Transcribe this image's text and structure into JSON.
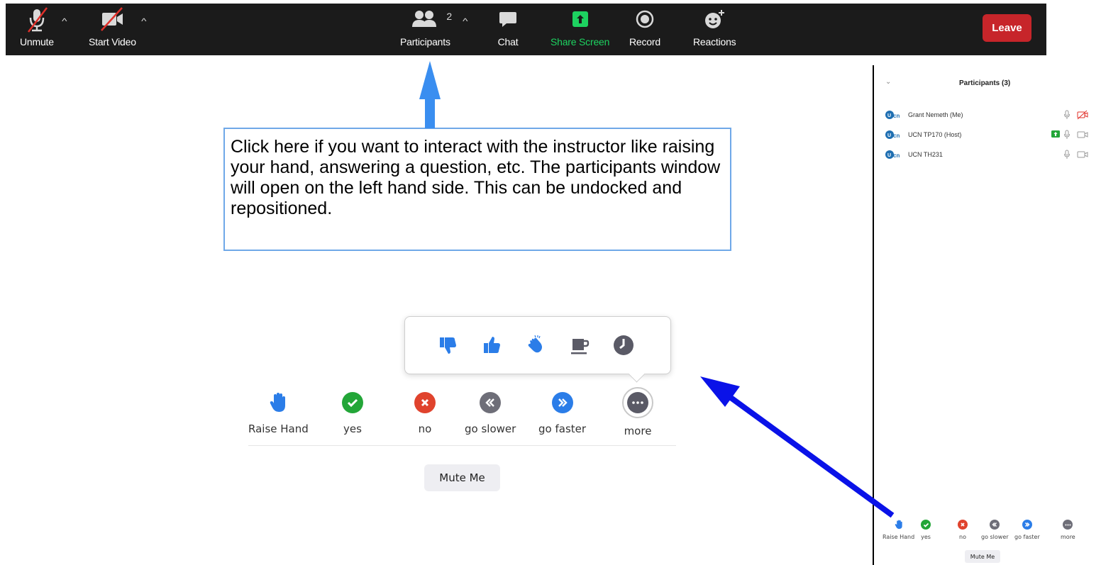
{
  "toolbar": {
    "unmute": {
      "label": "Unmute",
      "icon": "mic-muted-icon"
    },
    "start_video": {
      "label": "Start Video",
      "icon": "video-off-icon"
    },
    "participants": {
      "label": "Participants",
      "count": "2",
      "icon": "participants-icon"
    },
    "chat": {
      "label": "Chat",
      "icon": "chat-icon"
    },
    "share_screen": {
      "label": "Share Screen",
      "icon": "share-screen-icon",
      "color": "#1dd260"
    },
    "record": {
      "label": "Record",
      "icon": "record-icon"
    },
    "reactions": {
      "label": "Reactions",
      "icon": "reactions-icon"
    },
    "leave": {
      "label": "Leave",
      "color": "#c7252a"
    }
  },
  "callout": {
    "text": "Click here if you want to interact with the instructor like raising your hand, answering a question, etc.  The participants window will open on the left hand side.  This can be undocked and repositioned."
  },
  "reactions_popup": {
    "items": [
      "thumbs-down-icon",
      "thumbs-up-icon",
      "clap-icon",
      "coffee-icon",
      "clock-icon"
    ]
  },
  "feedback": {
    "raise_hand": "Raise Hand",
    "yes": "yes",
    "no": "no",
    "go_slower": "go slower",
    "go_faster": "go faster",
    "more": "more",
    "mute_me": "Mute Me",
    "colors": {
      "yes": "#23a638",
      "no": "#e0432d",
      "slower": "#6e6e78",
      "faster": "#2b7de8",
      "hand": "#2b7de8"
    }
  },
  "panel": {
    "title": "Participants (3)",
    "participants": [
      {
        "name": "Grant Nemeth (Me)",
        "mic": "mic-icon",
        "video": "video-off-icon"
      },
      {
        "name": "UCN TP170 (Host)",
        "share": "screen-share-icon",
        "mic": "mic-icon",
        "video": "video-icon"
      },
      {
        "name": "UCN TH231",
        "mic": "mic-icon",
        "video": "video-icon"
      }
    ],
    "feedback": {
      "raise_hand": "Raise Hand",
      "yes": "yes",
      "no": "no",
      "go_slower": "go slower",
      "go_faster": "go faster",
      "more": "more",
      "mute_me": "Mute Me"
    }
  }
}
